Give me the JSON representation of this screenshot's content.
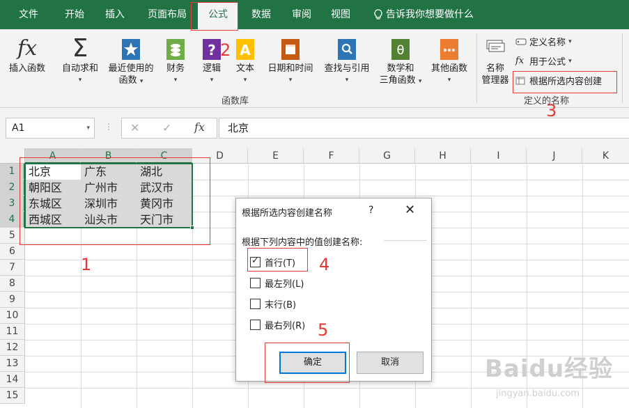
{
  "tabs": [
    {
      "label": "文件",
      "active": false
    },
    {
      "label": "开始",
      "active": false
    },
    {
      "label": "插入",
      "active": false
    },
    {
      "label": "页面布局",
      "active": false
    },
    {
      "label": "公式",
      "active": true
    },
    {
      "label": "数据",
      "active": false
    },
    {
      "label": "审阅",
      "active": false
    },
    {
      "label": "视图",
      "active": false
    }
  ],
  "tell_me": "告诉我你想要做什么",
  "ribbon": {
    "insert_function": "插入函数",
    "autosum": "自动求和",
    "recent": [
      "最近使用的",
      "函数"
    ],
    "financial": "财务",
    "logical": "逻辑",
    "text": "文本",
    "datetime": "日期和时间",
    "lookup": "查找与引用",
    "math": [
      "数学和",
      "三角函数"
    ],
    "more": "其他函数",
    "group_library": "函数库",
    "name_manager": [
      "名称",
      "管理器"
    ],
    "define_name": "定义名称",
    "use_in_formula": "用于公式",
    "create_from_selection": "根据所选内容创建",
    "group_defined_names": "定义的名称"
  },
  "formula_bar": {
    "name_box": "A1",
    "cancel": "✕",
    "enter": "✓",
    "fx": "fx",
    "value": "北京"
  },
  "columns": [
    "A",
    "B",
    "C",
    "D",
    "E",
    "F",
    "G",
    "H",
    "I",
    "J",
    "K"
  ],
  "rows": [
    "1",
    "2",
    "3",
    "4",
    "5",
    "6",
    "7",
    "8",
    "9",
    "10",
    "11",
    "12",
    "13",
    "14",
    "15"
  ],
  "cells": [
    [
      "北京",
      "广东",
      "湖北"
    ],
    [
      "朝阳区",
      "广州市",
      "武汉市"
    ],
    [
      "东城区",
      "深圳市",
      "黄冈市"
    ],
    [
      "西城区",
      "汕头市",
      "天门市"
    ]
  ],
  "dialog": {
    "title": "根据所选内容创建名称",
    "help": "?",
    "close": "✕",
    "prompt": "根据下列内容中的值创建名称:",
    "options": [
      {
        "label": "首行(T)",
        "checked": true
      },
      {
        "label": "最左列(L)",
        "checked": false
      },
      {
        "label": "末行(B)",
        "checked": false
      },
      {
        "label": "最右列(R)",
        "checked": false
      }
    ],
    "ok": "确定",
    "cancel": "取消"
  },
  "annotations": [
    "1",
    "2",
    "3",
    "4",
    "5"
  ],
  "watermark": {
    "main": "Baidu经验",
    "sub": "jingyan.baidu.com"
  },
  "colors": {
    "excel_green": "#217346",
    "annotation_red": "#e53935",
    "selection_fill": "#d9d9d9"
  }
}
